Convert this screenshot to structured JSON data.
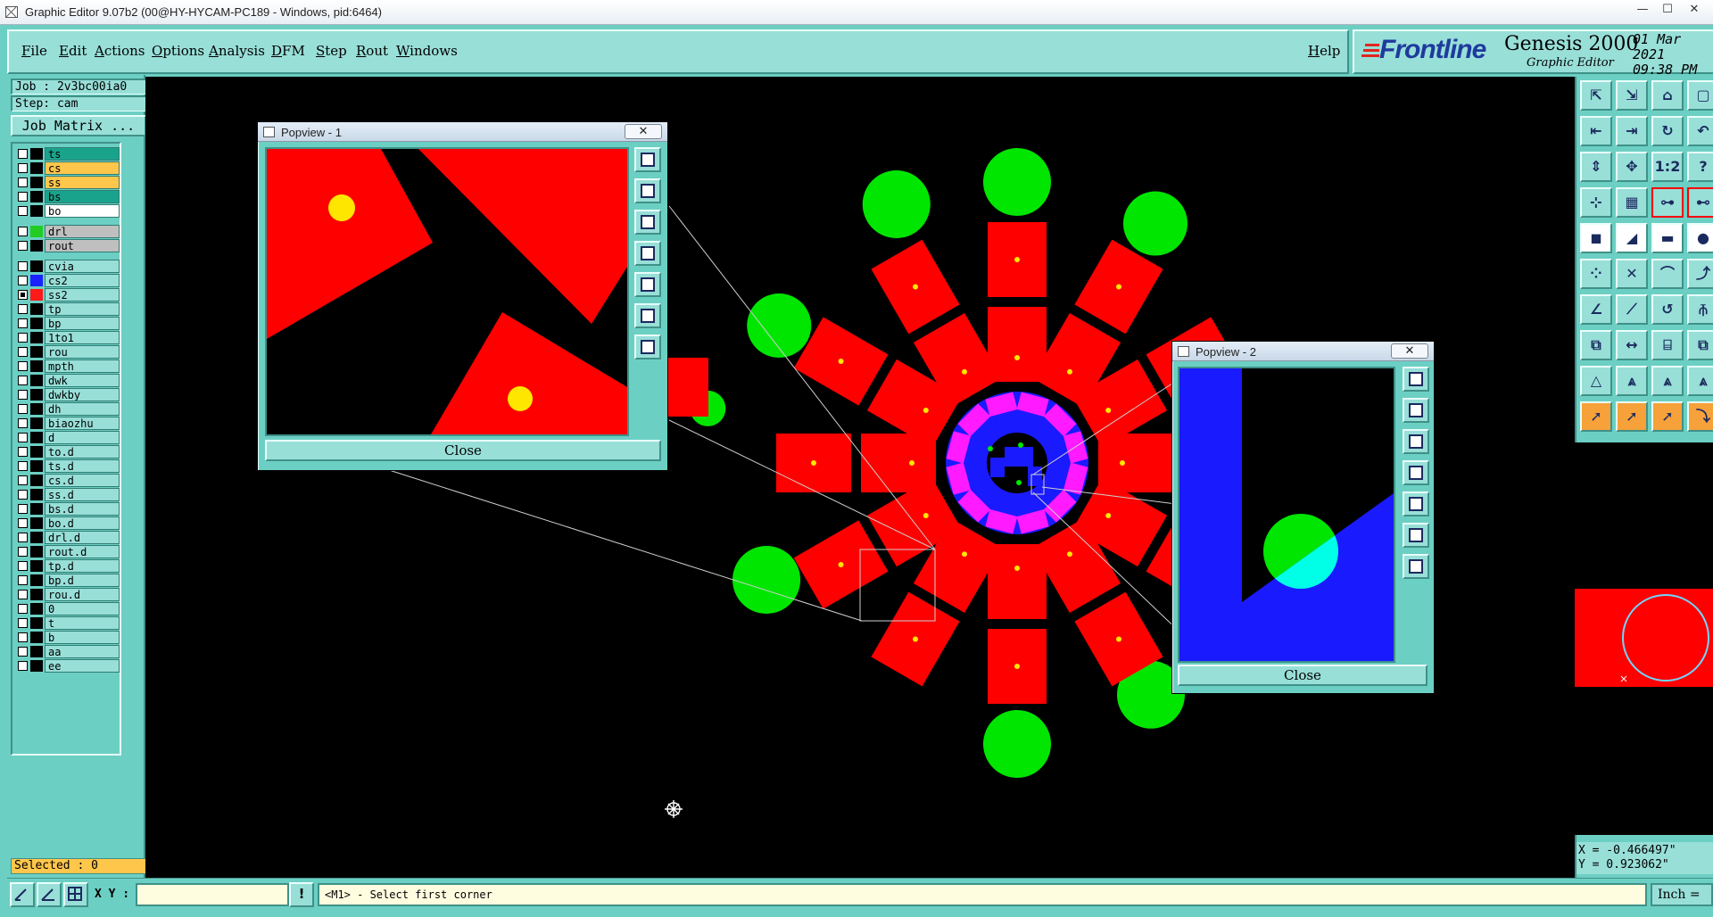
{
  "window": {
    "title": "Graphic Editor 9.07b2 (00@HY-HYCAM-PC189 - Windows, pid:6464)",
    "minimize_glyph": "—",
    "maximize_glyph": "☐",
    "close_glyph": "✕"
  },
  "menu": {
    "items": [
      "File",
      "Edit",
      "Actions",
      "Options",
      "Analysis",
      "DFM",
      "Step",
      "Rout",
      "Windows"
    ],
    "help": "Help"
  },
  "brand": {
    "logo": "Frontline",
    "product": "Genesis 2000",
    "subtitle": "Graphic Editor",
    "date": "01 Mar 2021",
    "time": "09:38 PM"
  },
  "job": {
    "job_label": "Job : 2v3bc00ia0",
    "step_label": "Step: cam",
    "matrix_button": "Job Matrix ...",
    "selected_label": "Selected : 0"
  },
  "layers": {
    "groups": [
      [
        {
          "name": "ts",
          "swatch": "#000000",
          "bg": "#1aa38c",
          "checked": false
        },
        {
          "name": "cs",
          "swatch": "#000000",
          "bg": "#ffc64c",
          "checked": false
        },
        {
          "name": "ss",
          "swatch": "#000000",
          "bg": "#ffc64c",
          "checked": false
        },
        {
          "name": "bs",
          "swatch": "#000000",
          "bg": "#1aa38c",
          "checked": false
        },
        {
          "name": "bo",
          "swatch": "#000000",
          "bg": "#ffffff",
          "checked": false
        }
      ],
      [
        {
          "name": "drl",
          "swatch": "#22cc22",
          "bg": "#bfbfbf",
          "checked": false
        },
        {
          "name": "rout",
          "swatch": "#000000",
          "bg": "#bfbfbf",
          "checked": false
        }
      ],
      [
        {
          "name": "cvia",
          "swatch": "#000000",
          "bg": "#98dfd8",
          "checked": false
        },
        {
          "name": "cs2",
          "swatch": "#1a22ff",
          "bg": "#98dfd8",
          "checked": false
        },
        {
          "name": "ss2",
          "swatch": "#ff1a1a",
          "bg": "#98dfd8",
          "checked": true
        },
        {
          "name": "tp",
          "swatch": "#000000",
          "bg": "#98dfd8",
          "checked": false
        },
        {
          "name": "bp",
          "swatch": "#000000",
          "bg": "#98dfd8",
          "checked": false
        },
        {
          "name": "1to1",
          "swatch": "#000000",
          "bg": "#98dfd8",
          "checked": false
        },
        {
          "name": "rou",
          "swatch": "#000000",
          "bg": "#98dfd8",
          "checked": false
        },
        {
          "name": "mpth",
          "swatch": "#000000",
          "bg": "#98dfd8",
          "checked": false
        },
        {
          "name": "dwk",
          "swatch": "#000000",
          "bg": "#98dfd8",
          "checked": false
        },
        {
          "name": "dwkby",
          "swatch": "#000000",
          "bg": "#98dfd8",
          "checked": false
        },
        {
          "name": "dh",
          "swatch": "#000000",
          "bg": "#98dfd8",
          "checked": false
        },
        {
          "name": "biaozhu",
          "swatch": "#000000",
          "bg": "#98dfd8",
          "checked": false
        },
        {
          "name": "d",
          "swatch": "#000000",
          "bg": "#98dfd8",
          "checked": false
        },
        {
          "name": "to.d",
          "swatch": "#000000",
          "bg": "#98dfd8",
          "checked": false
        },
        {
          "name": "ts.d",
          "swatch": "#000000",
          "bg": "#98dfd8",
          "checked": false
        },
        {
          "name": "cs.d",
          "swatch": "#000000",
          "bg": "#98dfd8",
          "checked": false
        },
        {
          "name": "ss.d",
          "swatch": "#000000",
          "bg": "#98dfd8",
          "checked": false
        },
        {
          "name": "bs.d",
          "swatch": "#000000",
          "bg": "#98dfd8",
          "checked": false
        },
        {
          "name": "bo.d",
          "swatch": "#000000",
          "bg": "#98dfd8",
          "checked": false
        },
        {
          "name": "drl.d",
          "swatch": "#000000",
          "bg": "#98dfd8",
          "checked": false
        },
        {
          "name": "rout.d",
          "swatch": "#000000",
          "bg": "#98dfd8",
          "checked": false
        },
        {
          "name": "tp.d",
          "swatch": "#000000",
          "bg": "#98dfd8",
          "checked": false
        },
        {
          "name": "bp.d",
          "swatch": "#000000",
          "bg": "#98dfd8",
          "checked": false
        },
        {
          "name": "rou.d",
          "swatch": "#000000",
          "bg": "#98dfd8",
          "checked": false
        },
        {
          "name": "0",
          "swatch": "#000000",
          "bg": "#98dfd8",
          "checked": false
        },
        {
          "name": "t",
          "swatch": "#000000",
          "bg": "#98dfd8",
          "checked": false
        },
        {
          "name": "b",
          "swatch": "#000000",
          "bg": "#98dfd8",
          "checked": false
        },
        {
          "name": "aa",
          "swatch": "#000000",
          "bg": "#98dfd8",
          "checked": false
        },
        {
          "name": "ee",
          "swatch": "#000000",
          "bg": "#98dfd8",
          "checked": false
        }
      ]
    ]
  },
  "popview1": {
    "title": "Popview - 1",
    "close_label": "Close",
    "close_x": "✕"
  },
  "popview2": {
    "title": "Popview - 2",
    "close_label": "Close",
    "close_x": "✕"
  },
  "toolbox": {
    "rows": [
      [
        {
          "icon": "zoom-home-icon",
          "glyph": "⇱"
        },
        {
          "icon": "zoom-out-icon",
          "glyph": "⇲"
        },
        {
          "icon": "home-icon",
          "glyph": "⌂"
        },
        {
          "icon": "pan-icon",
          "glyph": "▢"
        }
      ],
      [
        {
          "icon": "pan-left-icon",
          "glyph": "⇤"
        },
        {
          "icon": "pan-right-icon",
          "glyph": "⇥"
        },
        {
          "icon": "redraw-icon",
          "glyph": "↻"
        },
        {
          "icon": "undo-icon",
          "glyph": "↶"
        }
      ],
      [
        {
          "icon": "fit-vertical-icon",
          "glyph": "⇕"
        },
        {
          "icon": "fit-all-icon",
          "glyph": "✥"
        },
        {
          "icon": "one-to-one-icon",
          "glyph": "1:2"
        },
        {
          "icon": "help-icon",
          "glyph": "?"
        }
      ],
      [
        {
          "icon": "snap-icon",
          "glyph": "⊹"
        },
        {
          "icon": "grid-icon",
          "glyph": "▦"
        },
        {
          "icon": "measure-icon",
          "glyph": "⊶"
        },
        {
          "icon": "net-icon",
          "glyph": "⊷"
        }
      ],
      [
        {
          "icon": "pad-icon",
          "glyph": "◼"
        },
        {
          "icon": "line-icon",
          "glyph": "◢"
        },
        {
          "icon": "ruler-icon",
          "glyph": "▬"
        },
        {
          "icon": "circle-icon",
          "glyph": "●"
        }
      ],
      [
        {
          "icon": "connect-icon",
          "glyph": "⁘"
        },
        {
          "icon": "cross-icon",
          "glyph": "✕"
        },
        {
          "icon": "arc-icon",
          "glyph": "⌒"
        },
        {
          "icon": "route-icon",
          "glyph": "⤴"
        }
      ],
      [
        {
          "icon": "angle-icon",
          "glyph": "∠"
        },
        {
          "icon": "diagonal-icon",
          "glyph": "⟋"
        },
        {
          "icon": "curve-icon",
          "glyph": "↺"
        },
        {
          "icon": "split-icon",
          "glyph": "⫚"
        }
      ],
      [
        {
          "icon": "move-icon",
          "glyph": "⧉"
        },
        {
          "icon": "stretch-icon",
          "glyph": "↔"
        },
        {
          "icon": "break-icon",
          "glyph": "⌸"
        },
        {
          "icon": "copy-icon",
          "glyph": "⧉"
        }
      ],
      [
        {
          "icon": "triangle-icon",
          "glyph": "△"
        },
        {
          "icon": "triangle-a-icon",
          "glyph": "⩓"
        },
        {
          "icon": "triangle-b-icon",
          "glyph": "⩓"
        },
        {
          "icon": "triangle-c-icon",
          "glyph": "⩓"
        }
      ],
      [
        {
          "icon": "select-icon",
          "glyph": "➚"
        },
        {
          "icon": "select-box-icon",
          "glyph": "➚"
        },
        {
          "icon": "select-poly-icon",
          "glyph": "➚"
        },
        {
          "icon": "select-path-icon",
          "glyph": "⤵"
        }
      ]
    ]
  },
  "coordinates": {
    "x": "X = -0.466497\"",
    "y": "Y = 0.923062\""
  },
  "status": {
    "xy_label": "X Y :",
    "xy_value": "",
    "warn_glyph": "!",
    "prompt": "<M1> - Select first corner",
    "units": "Inch ="
  },
  "colors": {
    "pad": "#ff0000",
    "drill": "#00e600",
    "copper": "#1a1aff",
    "overlap": "#ff1aff",
    "via_dot": "#ffe600",
    "drill_overlap": "#00ffe6",
    "panel": "#6ccfc3"
  }
}
